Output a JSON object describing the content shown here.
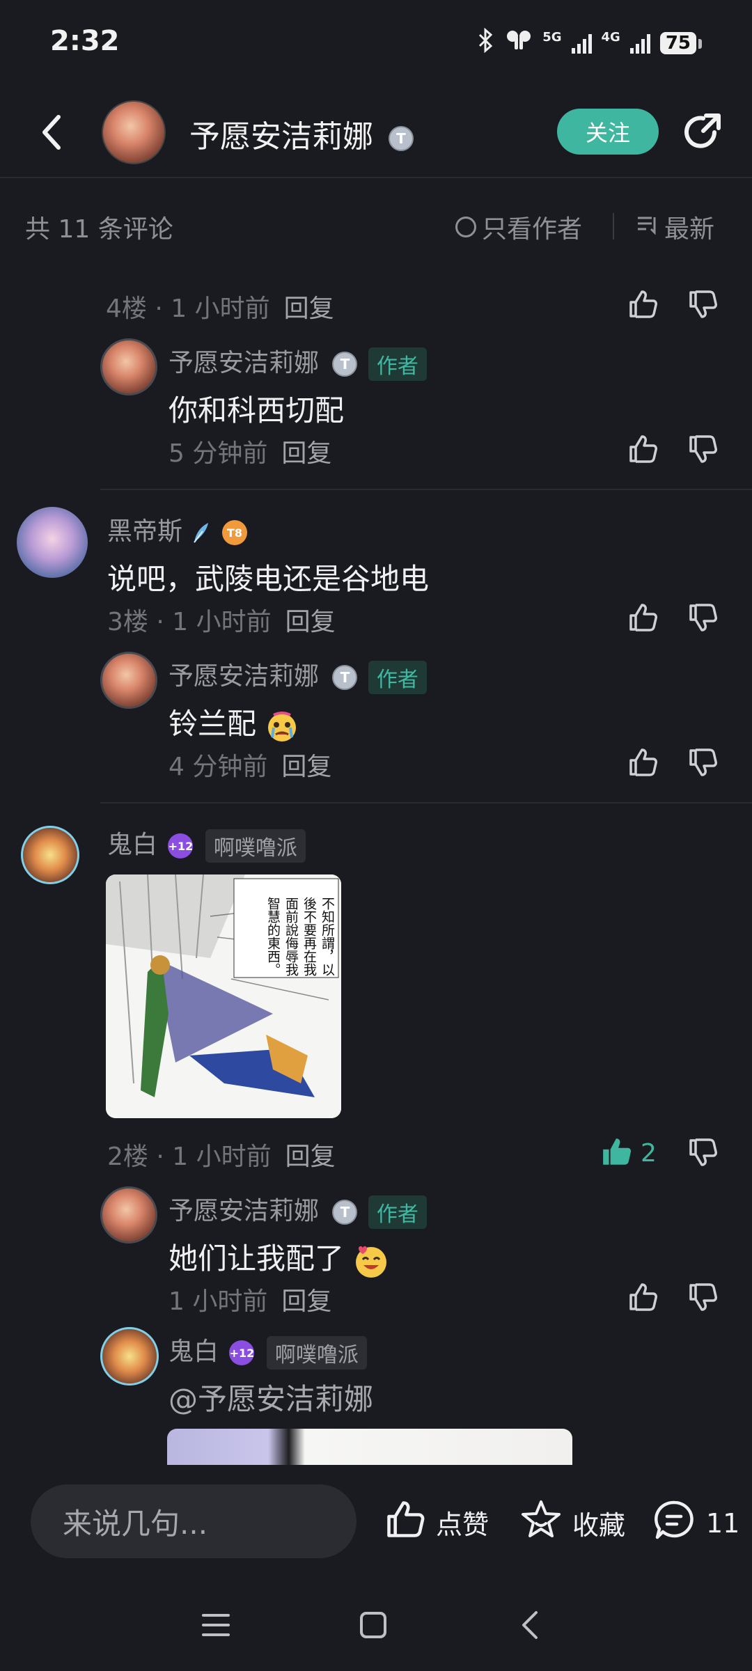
{
  "status_bar": {
    "time": "2:32",
    "network_5g": "5G",
    "network_4g": "4G",
    "battery": "75"
  },
  "header": {
    "title": "予愿安洁莉娜",
    "follow_label": "关注"
  },
  "filter_bar": {
    "total": "共 11 条评论",
    "only_author": "只看作者",
    "sort": "最新"
  },
  "comments": {
    "c4": {
      "meta_time": "4楼 · 1 小时前",
      "reply_label": "回复",
      "reply": {
        "name": "予愿安洁莉娜",
        "tag": "作者",
        "content": "你和科西切配",
        "time": "5 分钟前",
        "reply_label": "回复"
      }
    },
    "c3": {
      "name": "黑帝斯",
      "level": "8",
      "content": "说吧，武陵电还是谷地电",
      "meta_time": "3楼 · 1 小时前",
      "reply_label": "回复",
      "reply": {
        "name": "予愿安洁莉娜",
        "tag": "作者",
        "content": "铃兰配",
        "time": "4 分钟前",
        "reply_label": "回复"
      }
    },
    "c2": {
      "name": "鬼白",
      "level": "+12",
      "group": "啊噗噜派",
      "manga_text": [
        "不知所謂，以",
        "後不要再在我",
        "面前說侮辱我",
        "智慧的東西。"
      ],
      "meta_time": "2楼 · 1 小时前",
      "reply_label": "回复",
      "like_count": "2",
      "reply": {
        "name": "予愿安洁莉娜",
        "tag": "作者",
        "content": "她们让我配了",
        "time": "1 小时前",
        "reply_label": "回复"
      },
      "reply2": {
        "name": "鬼白",
        "level": "+12",
        "group": "啊噗噜派",
        "content": "@予愿安洁莉娜"
      }
    }
  },
  "bottom_bar": {
    "input_placeholder": "来说几句...",
    "like_label": "点赞",
    "fav_label": "收藏",
    "comment_count": "11"
  },
  "colors": {
    "background": "#1a1b20",
    "accent": "#3fb6a0",
    "author_tag_bg": "#1f3a35"
  }
}
